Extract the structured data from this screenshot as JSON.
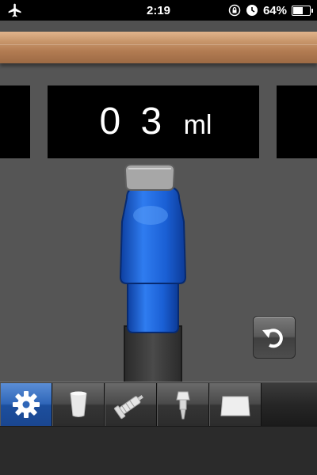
{
  "status_bar": {
    "time": "2:19",
    "battery_text": "64%",
    "battery_level": 0.64,
    "icons": [
      "airplane-icon",
      "rotation-lock-icon",
      "alarm-icon",
      "battery-icon"
    ]
  },
  "dial": {
    "digits": [
      "0",
      "3"
    ],
    "unit": "ml"
  },
  "bottle": {
    "cap_color": "#a9a9a9",
    "body_color": "#1a60d6",
    "stand_color": "#3c3c3c"
  },
  "controls": {
    "undo_icon": "undo-icon"
  },
  "toolbar": {
    "items": [
      {
        "icon": "gear-icon",
        "active": true
      },
      {
        "icon": "cup-icon",
        "active": false
      },
      {
        "icon": "syringe-icon",
        "active": false
      },
      {
        "icon": "dropper-icon",
        "active": false
      },
      {
        "icon": "tray-icon",
        "active": false
      }
    ],
    "active_color": "#2f66b8"
  }
}
